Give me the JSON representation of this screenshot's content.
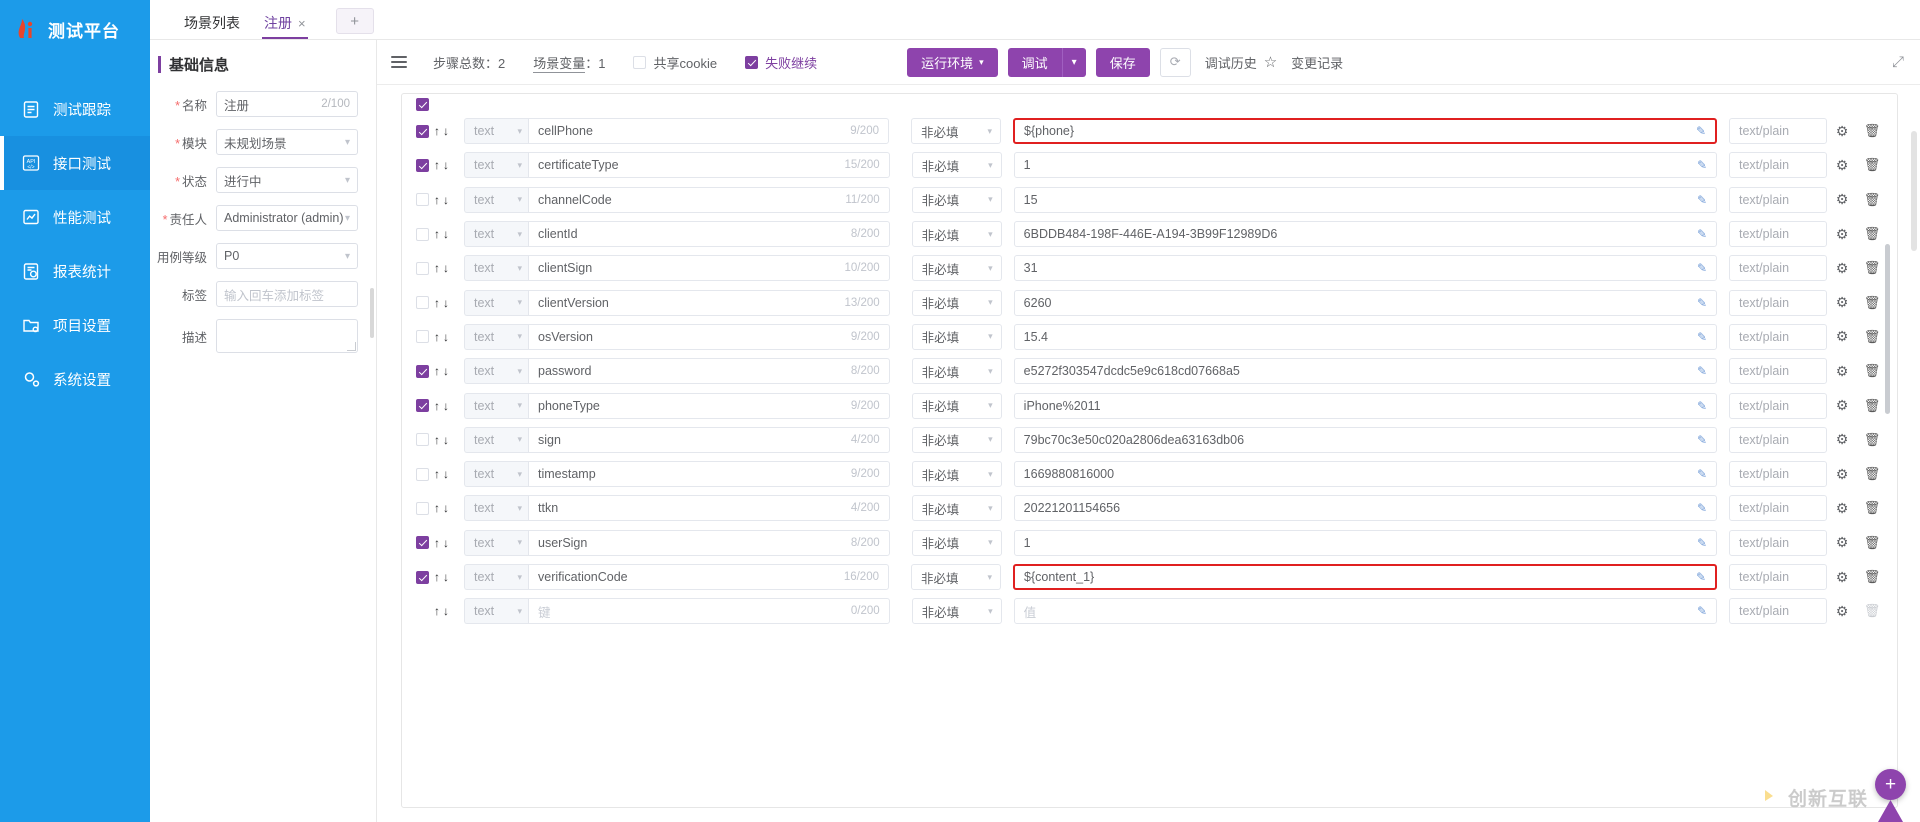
{
  "brand": {
    "title": "测试平台",
    "logo_icon": "flame-logo-icon"
  },
  "sidebar": {
    "items": [
      {
        "label": "测试跟踪",
        "icon": "clipboard-icon",
        "active": false
      },
      {
        "label": "接口测试",
        "icon": "api-icon",
        "active": true
      },
      {
        "label": "性能测试",
        "icon": "chart-line-icon",
        "active": false
      },
      {
        "label": "报表统计",
        "icon": "report-icon",
        "active": false
      },
      {
        "label": "项目设置",
        "icon": "folder-gear-icon",
        "active": false
      },
      {
        "label": "系统设置",
        "icon": "gears-icon",
        "active": false
      }
    ]
  },
  "tabs": {
    "items": [
      {
        "label": "场景列表",
        "active": false,
        "closable": false
      },
      {
        "label": "注册",
        "active": true,
        "closable": true
      }
    ],
    "close_glyph": "×",
    "add_label": "+"
  },
  "form": {
    "section_title": "基础信息",
    "fields": [
      {
        "label": "名称",
        "required": true,
        "value": "注册",
        "counter": "2/100",
        "type": "input"
      },
      {
        "label": "模块",
        "required": true,
        "value": "未规划场景",
        "type": "select"
      },
      {
        "label": "状态",
        "required": true,
        "value": "进行中",
        "type": "select"
      },
      {
        "label": "责任人",
        "required": true,
        "value": "Administrator (admin)",
        "type": "select"
      },
      {
        "label": "用例等级",
        "required": false,
        "value": "P0",
        "type": "select"
      },
      {
        "label": "标签",
        "required": false,
        "value": "",
        "placeholder": "输入回车添加标签",
        "type": "input"
      },
      {
        "label": "描述",
        "required": false,
        "value": "",
        "placeholder": "",
        "type": "textarea"
      }
    ]
  },
  "toolbar": {
    "menu_icon": "hamburger-icon",
    "step_total_label": "步骤总数：2",
    "scene_var_label": "场景变量",
    "scene_var_value": "：1",
    "share_cookie_label": "共享cookie",
    "share_cookie_checked": false,
    "fail_continue_label": "失败继续",
    "fail_continue_checked": true,
    "run_env_label": "运行环境",
    "debug_label": "调试",
    "save_label": "保存",
    "refresh_icon": "refresh-icon",
    "debug_history_label": "调试历史",
    "star_icon": "star-icon",
    "change_log_label": "变更记录",
    "expand_icon": "expand-icon",
    "caret_glyph": "▾"
  },
  "table": {
    "type_default": "text",
    "required_default": "非必填",
    "mime_default": "text/plain",
    "key_placeholder": "键",
    "value_placeholder": "值",
    "empty_counter": "0/200",
    "pencil_icon": "pencil-icon",
    "gear_icon": "gear-icon",
    "delete_icon": "trash-icon",
    "up_icon": "arrow-up-icon",
    "down_icon": "arrow-down-icon",
    "header_checked": true,
    "rows": [
      {
        "checked": true,
        "type": "text",
        "key": "cellPhone",
        "counter": "9/200",
        "required": "非必填",
        "value": "${phone}",
        "highlight": true,
        "mime": "text/plain"
      },
      {
        "checked": true,
        "type": "text",
        "key": "certificateType",
        "counter": "15/200",
        "required": "非必填",
        "value": "1",
        "highlight": false,
        "mime": "text/plain"
      },
      {
        "checked": false,
        "type": "text",
        "key": "channelCode",
        "counter": "11/200",
        "required": "非必填",
        "value": "15",
        "highlight": false,
        "mime": "text/plain"
      },
      {
        "checked": false,
        "type": "text",
        "key": "clientId",
        "counter": "8/200",
        "required": "非必填",
        "value": "6BDDB484-198F-446E-A194-3B99F12989D6",
        "highlight": false,
        "mime": "text/plain"
      },
      {
        "checked": false,
        "type": "text",
        "key": "clientSign",
        "counter": "10/200",
        "required": "非必填",
        "value": "31",
        "highlight": false,
        "mime": "text/plain"
      },
      {
        "checked": false,
        "type": "text",
        "key": "clientVersion",
        "counter": "13/200",
        "required": "非必填",
        "value": "6260",
        "highlight": false,
        "mime": "text/plain"
      },
      {
        "checked": false,
        "type": "text",
        "key": "osVersion",
        "counter": "9/200",
        "required": "非必填",
        "value": "15.4",
        "highlight": false,
        "mime": "text/plain"
      },
      {
        "checked": true,
        "type": "text",
        "key": "password",
        "counter": "8/200",
        "required": "非必填",
        "value": "e5272f303547dcdc5e9c618cd07668a5",
        "highlight": false,
        "mime": "text/plain"
      },
      {
        "checked": true,
        "type": "text",
        "key": "phoneType",
        "counter": "9/200",
        "required": "非必填",
        "value": "iPhone%2011",
        "highlight": false,
        "mime": "text/plain"
      },
      {
        "checked": false,
        "type": "text",
        "key": "sign",
        "counter": "4/200",
        "required": "非必填",
        "value": "79bc70c3e50c020a2806dea63163db06",
        "highlight": false,
        "mime": "text/plain"
      },
      {
        "checked": false,
        "type": "text",
        "key": "timestamp",
        "counter": "9/200",
        "required": "非必填",
        "value": "1669880816000",
        "highlight": false,
        "mime": "text/plain"
      },
      {
        "checked": false,
        "type": "text",
        "key": "ttkn",
        "counter": "4/200",
        "required": "非必填",
        "value": "20221201154656",
        "highlight": false,
        "mime": "text/plain"
      },
      {
        "checked": true,
        "type": "text",
        "key": "userSign",
        "counter": "8/200",
        "required": "非必填",
        "value": "1",
        "highlight": false,
        "mime": "text/plain"
      },
      {
        "checked": true,
        "type": "text",
        "key": "verificationCode",
        "counter": "16/200",
        "required": "非必填",
        "value": "${content_1}",
        "highlight": true,
        "mime": "text/plain"
      }
    ]
  },
  "watermark": {
    "text": "创新互联",
    "logo_icon": "cx-logo-icon"
  },
  "fab": {
    "label": "+",
    "icon": "add-icon"
  },
  "colors": {
    "sidebar": "#1c9be9",
    "accent": "#8e44ad",
    "highlight": "#e02020",
    "checked": "#7d3fa0"
  }
}
